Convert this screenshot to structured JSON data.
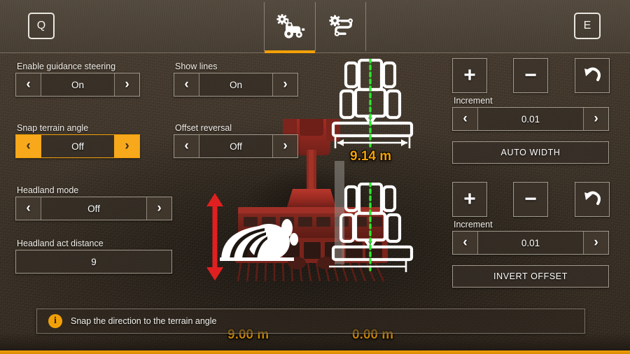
{
  "header": {
    "key_left": "Q",
    "key_right": "E",
    "tabs": [
      {
        "name": "vehicle-settings",
        "icon": "tractor-gear-icon",
        "active": true
      },
      {
        "name": "route-settings",
        "icon": "gear-route-icon",
        "active": false
      }
    ]
  },
  "settings": {
    "enable_guidance_steering": {
      "label": "Enable guidance steering",
      "value": "On",
      "selected": false
    },
    "show_lines": {
      "label": "Show lines",
      "value": "On",
      "selected": false
    },
    "snap_terrain_angle": {
      "label": "Snap terrain angle",
      "value": "Off",
      "selected": true
    },
    "offset_reversal": {
      "label": "Offset reversal",
      "value": "Off",
      "selected": false
    },
    "headland_mode": {
      "label": "Headland mode",
      "value": "Off",
      "selected": false
    },
    "headland_act_distance": {
      "label": "Headland act distance",
      "value": "9"
    }
  },
  "arrows": {
    "left": "‹",
    "right": "›"
  },
  "width_panel": {
    "plus_label": "+",
    "minus_label": "−",
    "reset_icon": "undo-arrow-icon",
    "increment_label": "Increment",
    "increment_value": "0.01",
    "action_label": "AUTO WIDTH"
  },
  "offset_panel": {
    "plus_label": "+",
    "minus_label": "−",
    "reset_icon": "undo-arrow-icon",
    "increment_label": "Increment",
    "increment_value": "0.01",
    "action_label": "INVERT OFFSET"
  },
  "visualization": {
    "working_width": "9.14 m",
    "headland_distance": "9.00 m",
    "offset_value": "0.00 m"
  },
  "help": {
    "icon": "info-icon",
    "text": "Snap the direction to the terrain angle"
  },
  "colors": {
    "accent": "#f2a007",
    "selected_button": "#f7a81b",
    "measure_text": "#f2a007",
    "center_line": "#2ee62e",
    "offset_line": "#e02020",
    "panel_border": "#c4bdaf",
    "text": "#f4f2ed"
  }
}
